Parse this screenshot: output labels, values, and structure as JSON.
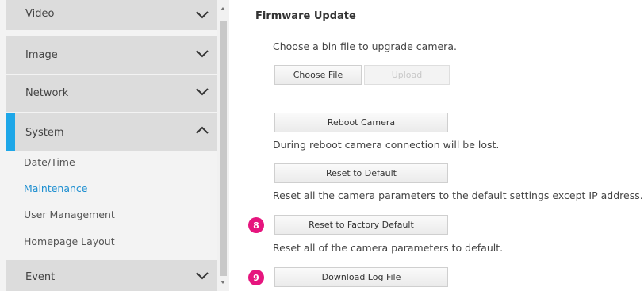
{
  "sidebar": {
    "sections": [
      {
        "label": "Video",
        "chevron": "chevron-down"
      },
      {
        "label": "Image",
        "chevron": "chevron-down"
      },
      {
        "label": "Network",
        "chevron": "chevron-down"
      },
      {
        "label": "System",
        "chevron": "chevron-up"
      },
      {
        "label": "Event",
        "chevron": "chevron-down"
      }
    ],
    "system_items": [
      "Date/Time",
      "Maintenance",
      "User Management",
      "Homepage Layout"
    ],
    "active_item": "Maintenance",
    "accent_color": "#1ea7e8"
  },
  "main": {
    "title": "Firmware Update",
    "choose_text": "Choose a bin file to upgrade camera.",
    "choose_file_label": "Choose File",
    "upload_label": "Upload",
    "reboot_label": "Reboot Camera",
    "reboot_note": "During reboot camera connection will be lost.",
    "reset_default_label": "Reset to Default",
    "reset_default_note": "Reset all the camera parameters to the default settings except IP address.",
    "badge_8": "8",
    "reset_factory_label": "Reset to Factory Default",
    "reset_factory_note": "Reset all of the camera parameters to default.",
    "badge_9": "9",
    "download_log_label": "Download Log File",
    "badge_color": "#e6157e"
  }
}
